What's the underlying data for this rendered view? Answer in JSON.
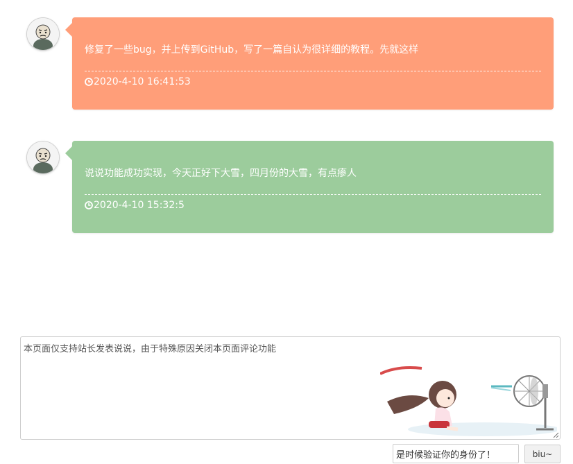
{
  "posts": [
    {
      "text": "修复了一些bug，并上传到GitHub，写了一篇自认为很详细的教程。先就这样",
      "time": "2020-4-10 16:41:53",
      "color": "#ff9e79"
    },
    {
      "text": "说说功能成功实现，今天正好下大雪，四月份的大雪，有点瘆人",
      "time": "2020-4-10 15:32:5",
      "color": "#9ccc9c"
    }
  ],
  "comment": {
    "value": "本页面仅支持站长发表说说，由于特殊原因关闭本页面评论功能",
    "captcha_value": "是时候验证你的身份了！",
    "submit_label": "biu~"
  },
  "icons": {
    "avatar": "avatar-icon",
    "clock": "clock-icon",
    "illustration": "girl-fan-illustration"
  }
}
